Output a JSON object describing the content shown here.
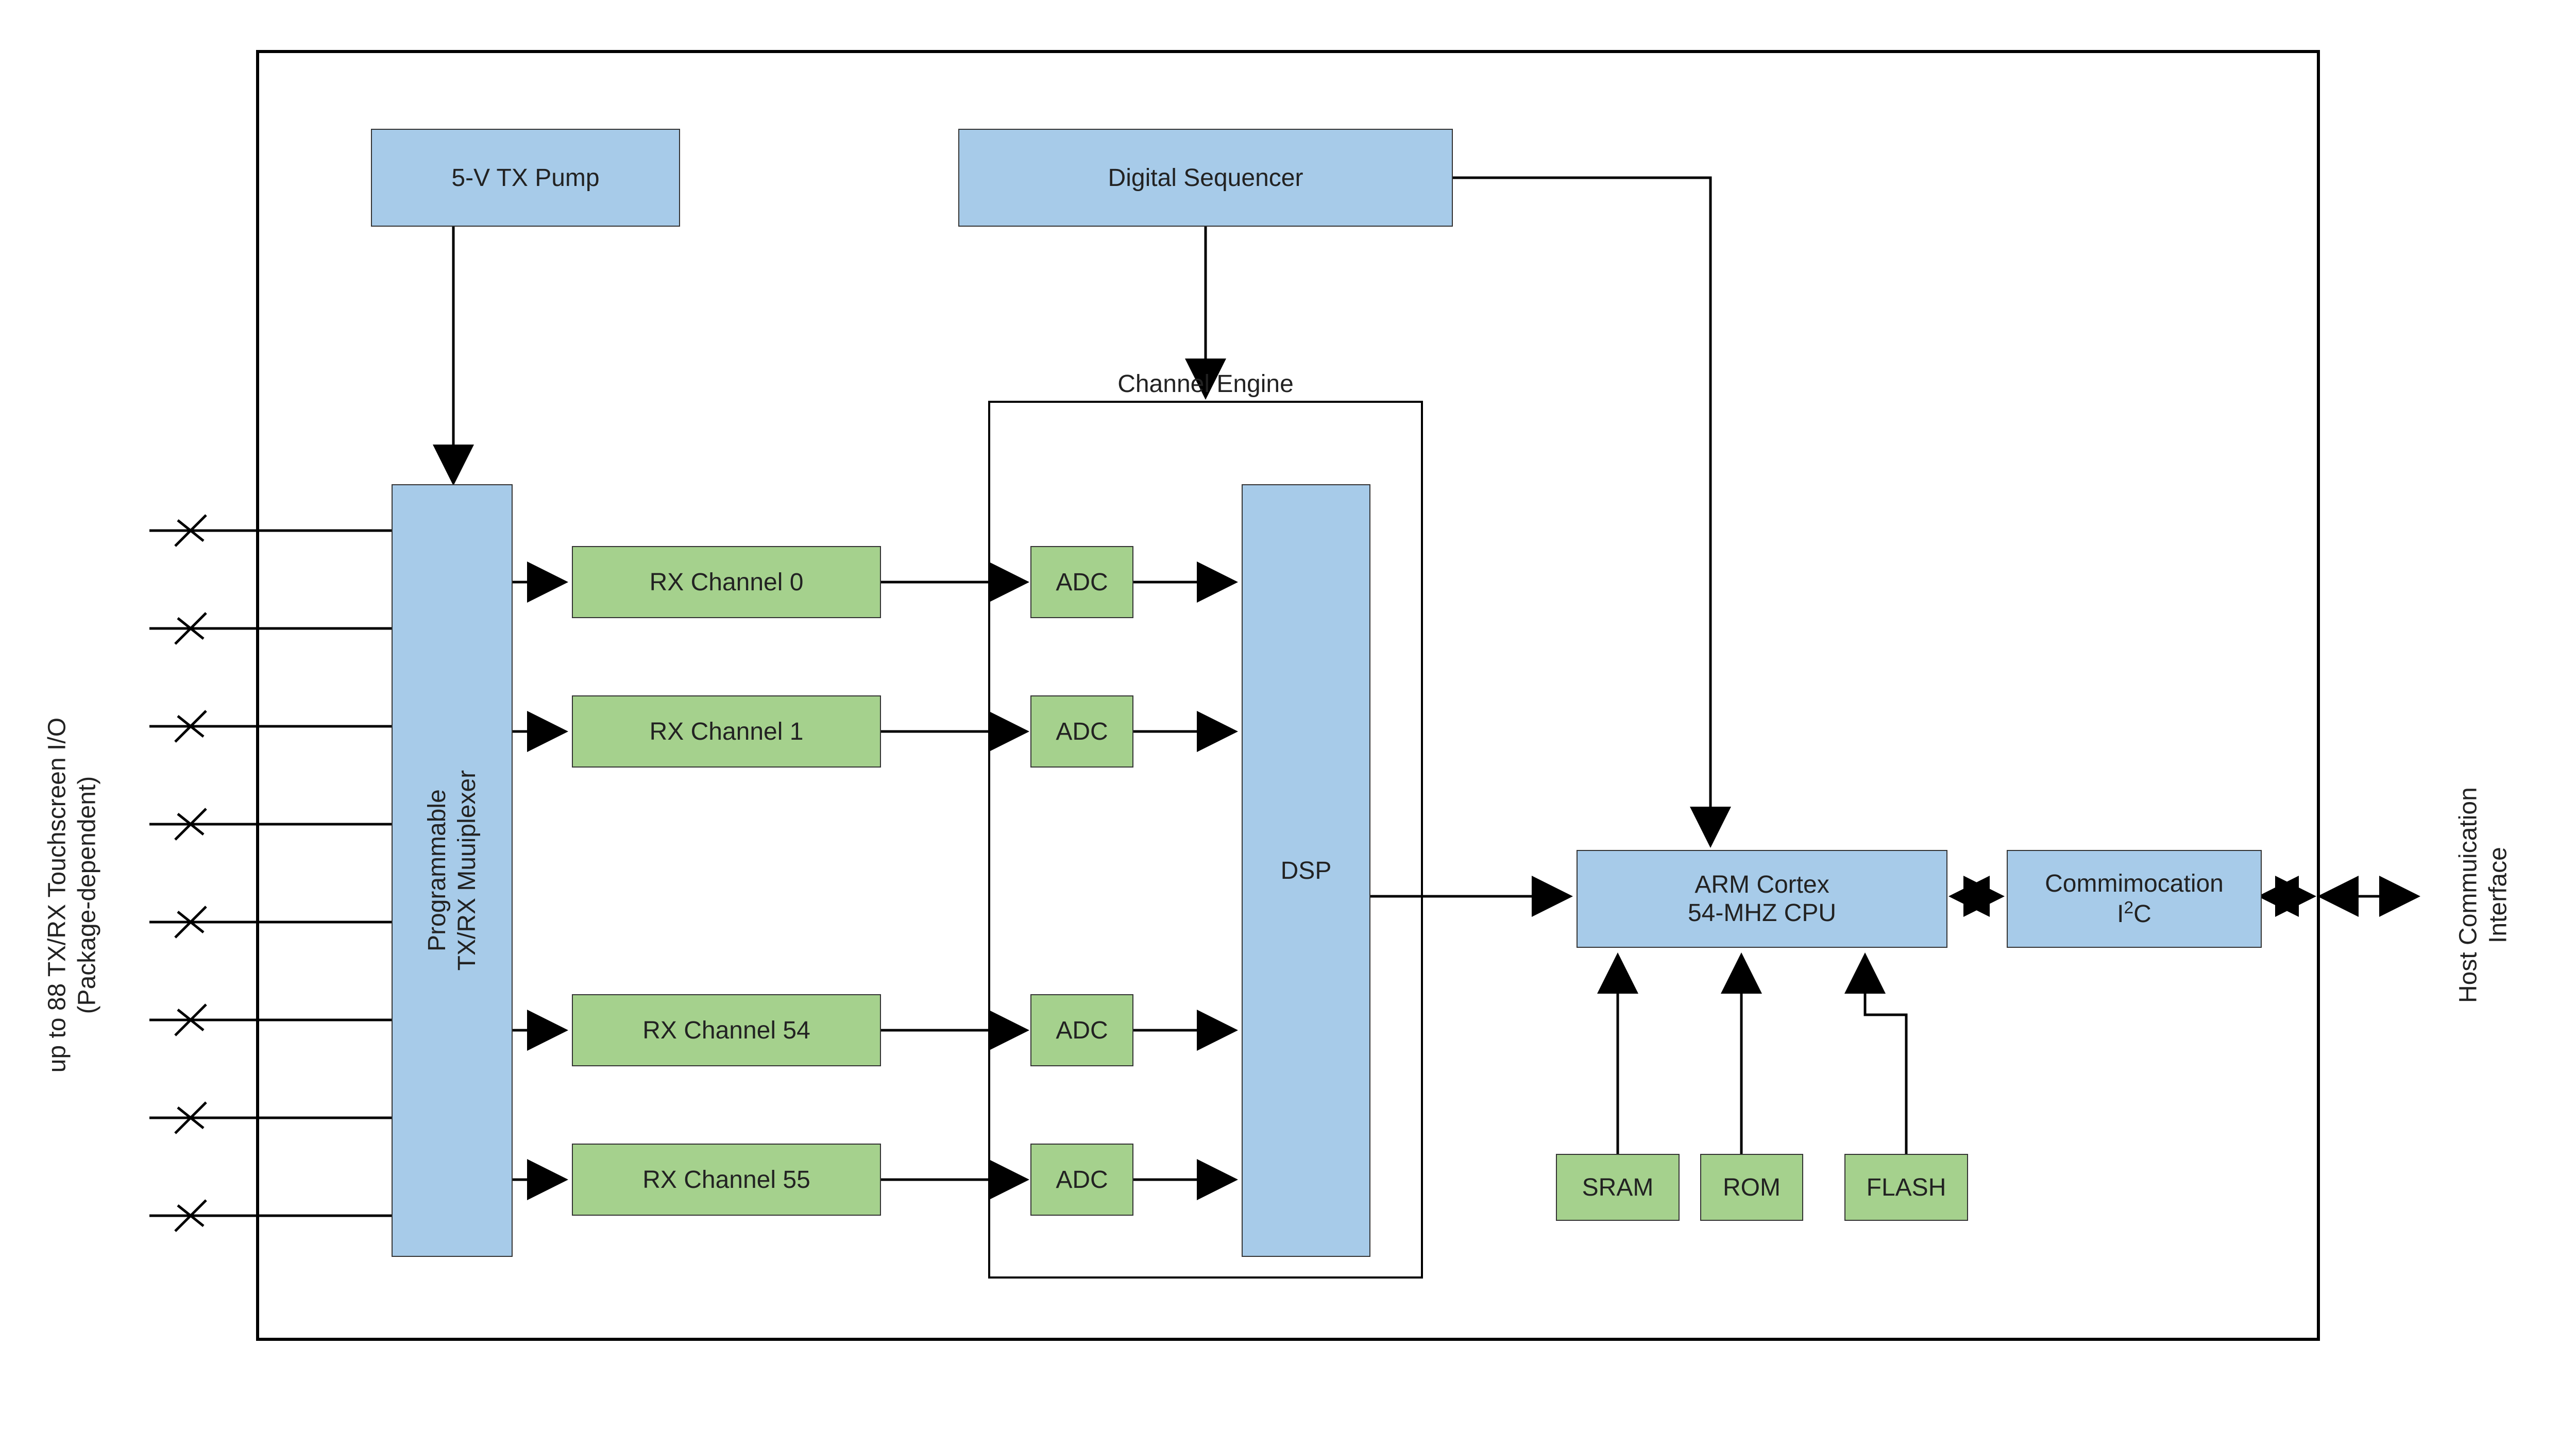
{
  "left_label_line1": "up to 88 TX/RX Touchscreen I/O",
  "left_label_line2": "(Package-dependent)",
  "right_label_line1": "Host Commuication",
  "right_label_line2": "Interface",
  "tx_pump": "5-V TX Pump",
  "seq": "Digital Sequencer",
  "channel_engine": "Channel Engine",
  "mux_line1": "Programmable",
  "mux_line2": "TX/RX Muuiplexer",
  "rx0": "RX Channel 0",
  "rx1": "RX Channel 1",
  "rx54": "RX Channel 54",
  "rx55": "RX Channel 55",
  "adc": "ADC",
  "dsp": "DSP",
  "cpu_line1": "ARM Cortex",
  "cpu_line2": "54-MHZ CPU",
  "comm_line1": "Commimocation",
  "comm_i2c_prefix": "I",
  "comm_i2c_sup": "2",
  "comm_i2c_suffix": "C",
  "sram": "SRAM",
  "rom": "ROM",
  "flash": "FLASH"
}
